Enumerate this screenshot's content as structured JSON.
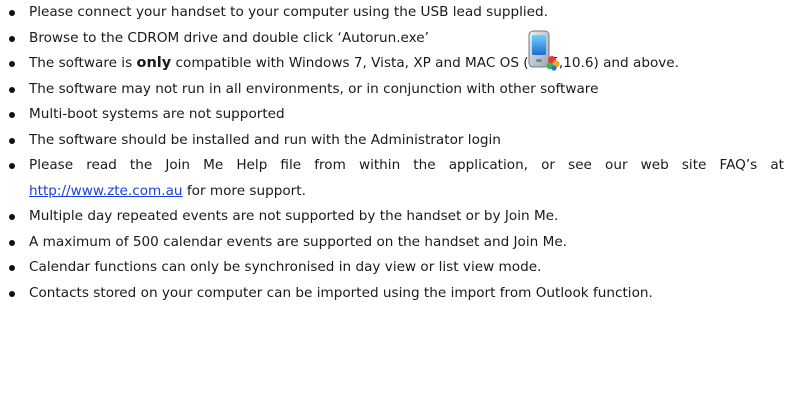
{
  "bullets": [
    {
      "text": "Please connect your handset to your computer using the USB lead supplied."
    },
    {
      "text": "Browse to the CDROM drive and double click ‘Autorun.exe’"
    },
    {
      "before": "The software is ",
      "emphasis": "only",
      "after": " compatible with Windows 7, Vista, XP and MAC OS (10.5,10.6) and above."
    },
    {
      "text": "The software may not run in all environments, or in conjunction with other software"
    },
    {
      "text": "Multi-boot systems are not supported"
    },
    {
      "text": "The software should be installed and run with the Administrator login"
    },
    {
      "before": "Please read the Join Me Help file from within the application, or see our web site FAQ’s at ",
      "link": "http://www.zte.com.au",
      "after": " for more support."
    },
    {
      "text": "Multiple day repeated events are not supported by the handset or by Join Me."
    },
    {
      "text": "A maximum of 500 calendar events are supported on the handset and Join Me."
    },
    {
      "text": "Calendar functions can only be synchronised in day view or list view mode."
    },
    {
      "text": "Contacts stored on your computer can be imported using the import from Outlook function."
    }
  ],
  "icons": {
    "autorun": "autorun-installer-icon"
  },
  "colors": {
    "link": "#1a3ee6",
    "text": "#1a1a1a"
  }
}
